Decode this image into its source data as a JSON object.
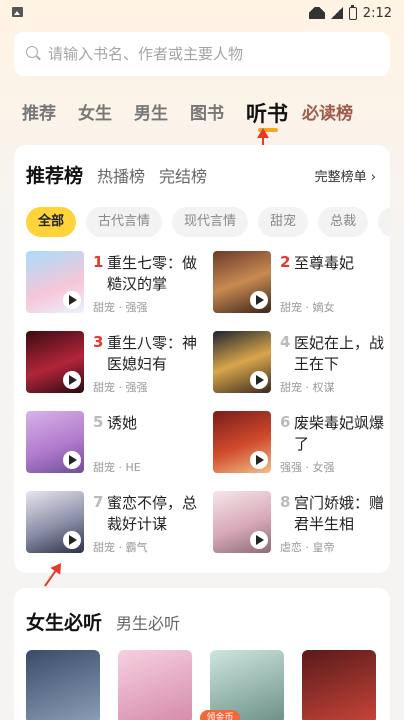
{
  "status": {
    "time": "2:12"
  },
  "search": {
    "placeholder": "请输入书名、作者或主要人物"
  },
  "tabs": [
    {
      "label": "推荐"
    },
    {
      "label": "女生"
    },
    {
      "label": "男生"
    },
    {
      "label": "图书"
    },
    {
      "label": "听书"
    },
    {
      "label": "必读榜"
    }
  ],
  "ranking": {
    "tabs": [
      {
        "label": "推荐榜"
      },
      {
        "label": "热播榜"
      },
      {
        "label": "完结榜"
      }
    ],
    "full_list": "完整榜单 ›",
    "filters": [
      "全部",
      "古代言情",
      "现代言情",
      "甜宠",
      "总裁",
      "种田"
    ],
    "books": [
      {
        "rank": "1",
        "title": "重生七零：做糙汉的掌",
        "meta": "甜宠 · 强强"
      },
      {
        "rank": "2",
        "title": "至尊毒妃",
        "meta": "甜宠 · 嫡女"
      },
      {
        "rank": "3",
        "title": "重生八零：神医媳妇有",
        "meta": "甜宠 · 强强"
      },
      {
        "rank": "4",
        "title": "医妃在上，战王在下",
        "meta": "甜宠 · 权谋"
      },
      {
        "rank": "5",
        "title": "诱她",
        "meta": "甜宠 · HE"
      },
      {
        "rank": "6",
        "title": "废柴毒妃飒爆了",
        "meta": "强强 · 女强"
      },
      {
        "rank": "7",
        "title": "蜜恋不停，总裁好计谋",
        "meta": "甜宠 · 霸气"
      },
      {
        "rank": "8",
        "title": "宫门娇娥：赠君半生相",
        "meta": "虐恋 · 皇帝"
      }
    ]
  },
  "must_listen": {
    "tabs": [
      {
        "label": "女生必听"
      },
      {
        "label": "男生必听"
      }
    ]
  },
  "bottom": {
    "badge": "领金币"
  }
}
